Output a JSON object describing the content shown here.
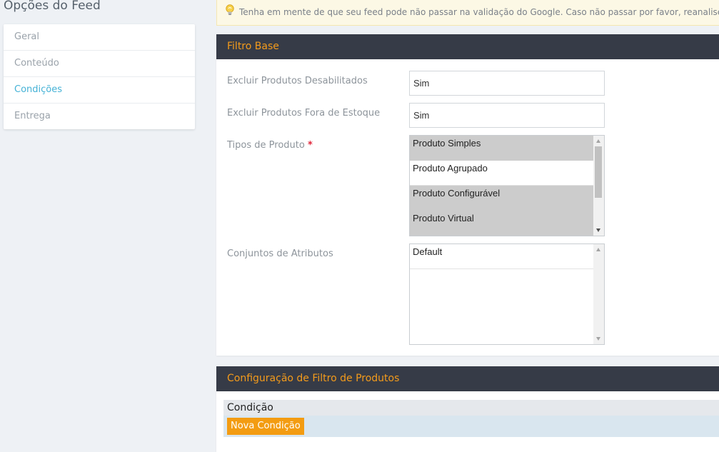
{
  "page_title": "Opções do Feed",
  "sidebar": {
    "items": [
      {
        "label": "Geral"
      },
      {
        "label": "Conteúdo"
      },
      {
        "label": "Condições"
      },
      {
        "label": "Entrega"
      }
    ],
    "active_color": "#45b2d6"
  },
  "notice": {
    "icon": "lightbulb-icon",
    "text": "Tenha em mente de que seu feed pode não passar na validação do Google. Caso não passar por favor, reanalise as configurações"
  },
  "base_filter": {
    "title": "Filtro Base",
    "exclude_disabled": {
      "label": "Excluir Produtos Desabilitados",
      "value": "Sim"
    },
    "exclude_out_of_stock": {
      "label": "Excluir Produtos Fora de Estoque",
      "value": "Sim"
    },
    "product_types": {
      "label": "Tipos de Produto",
      "required_mark": "*",
      "options": [
        {
          "label": "Produto Simples",
          "selected": true
        },
        {
          "label": "Produto Agrupado",
          "selected": false
        },
        {
          "label": "Produto Configurável",
          "selected": true
        },
        {
          "label": "Produto Virtual",
          "selected": true
        }
      ]
    },
    "attribute_sets": {
      "label": "Conjuntos de Atributos",
      "options": [
        {
          "label": "Default",
          "selected": false
        }
      ]
    }
  },
  "product_filter": {
    "title": "Configuração de Filtro de Produtos",
    "condition_header": "Condição",
    "new_condition_button": "Nova Condição"
  },
  "colors": {
    "panel_header_bg": "#363b47",
    "panel_header_text": "#f49b1b",
    "button": "#f39c12"
  }
}
